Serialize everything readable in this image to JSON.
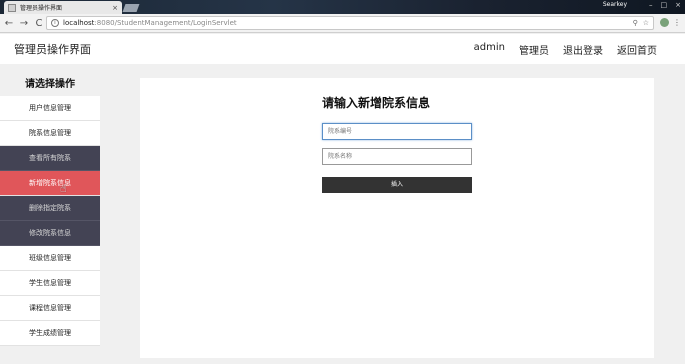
{
  "browser": {
    "tab_title": "管理员操作界面",
    "tab_close": "×",
    "profile_name": "Searkey",
    "window_buttons": [
      "–",
      "□",
      "×"
    ],
    "back": "←",
    "forward": "→",
    "reload": "C",
    "url_host": "localhost",
    "url_path": ":8080/StudentManagement/LoginServlet",
    "url_right_icons": [
      "⚲",
      "☆"
    ],
    "menu": "⋮"
  },
  "header": {
    "brand": "管理员操作界面",
    "nav": [
      "admin",
      "管理员",
      "退出登录",
      "返回首页"
    ]
  },
  "sidebar": {
    "title": "请选择操作",
    "items": [
      {
        "label": "用户信息管理",
        "type": "main"
      },
      {
        "label": "院系信息管理",
        "type": "main"
      },
      {
        "label": "查看所有院系",
        "type": "sub"
      },
      {
        "label": "新增院系信息",
        "type": "active"
      },
      {
        "label": "删除指定院系",
        "type": "sub"
      },
      {
        "label": "修改院系信息",
        "type": "sub"
      },
      {
        "label": "班级信息管理",
        "type": "main"
      },
      {
        "label": "学生信息管理",
        "type": "main"
      },
      {
        "label": "课程信息管理",
        "type": "main"
      },
      {
        "label": "学生成绩管理",
        "type": "main"
      }
    ]
  },
  "form": {
    "title": "请输入新增院系信息",
    "dept_id_placeholder": "院系编号",
    "dept_name_placeholder": "院系名称",
    "submit_label": "插入"
  }
}
